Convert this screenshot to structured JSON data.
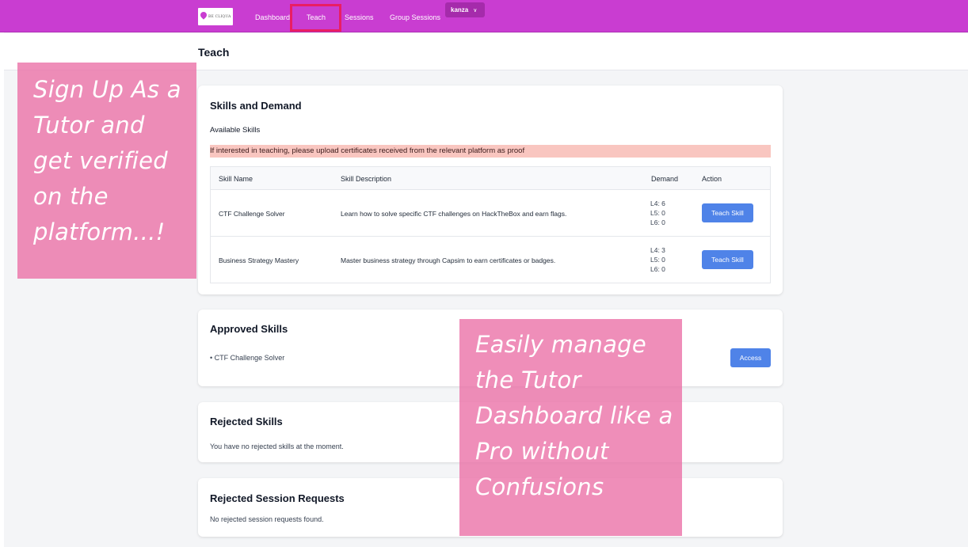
{
  "navbar": {
    "logo_text": "BE CLIQUA",
    "links": [
      "Dashboard",
      "Teach",
      "Sessions",
      "Group Sessions"
    ],
    "active": "Teach",
    "user": "kanza"
  },
  "page": {
    "title": "Teach"
  },
  "skills_card": {
    "title": "Skills and Demand",
    "subtitle": "Available Skills",
    "alert": "If interested in teaching, please upload certificates received from the relevant platform as proof",
    "columns": [
      "Skill Name",
      "Skill Description",
      "Demand",
      "Action"
    ],
    "rows": [
      {
        "name": "CTF Challenge Solver",
        "description": "Learn how to solve specific CTF challenges on HackTheBox and earn flags.",
        "demand": [
          "L4: 6",
          "L5: 0",
          "L6: 0"
        ],
        "action": "Teach Skill"
      },
      {
        "name": "Business Strategy Mastery",
        "description": "Master business strategy through Capsim to earn certificates or badges.",
        "demand": [
          "L4: 3",
          "L5: 0",
          "L6: 0"
        ],
        "action": "Teach Skill"
      }
    ]
  },
  "approved_card": {
    "title": "Approved Skills",
    "items": [
      "CTF Challenge Solver"
    ],
    "button": "Access"
  },
  "rejected_card": {
    "title": "Rejected Skills",
    "text": "You have no rejected skills at the moment."
  },
  "rejected_sessions_card": {
    "title": "Rejected Session Requests",
    "text": "No rejected session requests found."
  },
  "overlays": {
    "left": [
      "Sign Up As a",
      "Tutor and",
      "get verified",
      "on the",
      "platform...!"
    ],
    "right": [
      "Easily manage",
      "the Tutor",
      "Dashboard like a",
      "Pro without",
      "Confusions"
    ]
  },
  "colors": {
    "navbar": "#c93dd1",
    "active_highlight": "#e91e63",
    "button": "#4f83e8",
    "alert": "#f9c6c0",
    "overlay": "#eb6ea5"
  }
}
